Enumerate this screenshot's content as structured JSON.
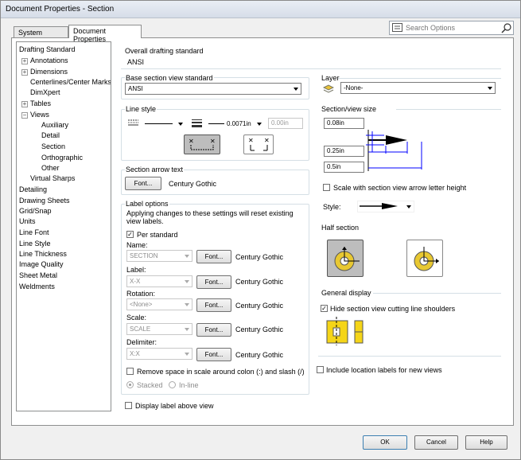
{
  "window": {
    "title": "Document Properties - Section"
  },
  "tabs": [
    {
      "label": "System Options"
    },
    {
      "label": "Document Properties"
    }
  ],
  "search": {
    "placeholder": "Search Options"
  },
  "tree": {
    "items": [
      {
        "label": "Drafting Standard"
      },
      {
        "label": "Annotations"
      },
      {
        "label": "Dimensions"
      },
      {
        "label": "Centerlines/Center Marks"
      },
      {
        "label": "DimXpert"
      },
      {
        "label": "Tables"
      },
      {
        "label": "Views"
      },
      {
        "label": "Auxiliary"
      },
      {
        "label": "Detail"
      },
      {
        "label": "Section"
      },
      {
        "label": "Orthographic"
      },
      {
        "label": "Other"
      },
      {
        "label": "Virtual Sharps"
      },
      {
        "label": "Detailing"
      },
      {
        "label": "Drawing Sheets"
      },
      {
        "label": "Grid/Snap"
      },
      {
        "label": "Units"
      },
      {
        "label": "Line Font"
      },
      {
        "label": "Line Style"
      },
      {
        "label": "Line Thickness"
      },
      {
        "label": "Image Quality"
      },
      {
        "label": "Sheet Metal"
      },
      {
        "label": "Weldments"
      }
    ]
  },
  "overall": {
    "label": "Overall drafting standard",
    "value": "ANSI"
  },
  "base_standard": {
    "label": "Base section view standard",
    "value": "ANSI"
  },
  "layer": {
    "label": "Layer",
    "value": "-None-"
  },
  "line_style": {
    "label": "Line style",
    "thickness": "0.0071in",
    "custom": "0.00in"
  },
  "section_size": {
    "label": "Section/view size",
    "v1": "0.08in",
    "v2": "0.25in",
    "v3": "0.5in"
  },
  "arrow_text": {
    "label": "Section arrow text",
    "font_btn": "Font...",
    "font": "Century Gothic"
  },
  "scale_with": {
    "label": "Scale with section view arrow letter height"
  },
  "style": {
    "label": "Style:"
  },
  "label_options": {
    "label": "Label options",
    "note": "Applying changes to these settings will reset existing view labels.",
    "per_standard": "Per standard",
    "name": {
      "label": "Name:",
      "value": "SECTION"
    },
    "lbl": {
      "label": "Label:",
      "value": "X-X"
    },
    "rotation": {
      "label": "Rotation:",
      "value": "<None>"
    },
    "scale": {
      "label": "Scale:",
      "value": "SCALE"
    },
    "delimiter": {
      "label": "Delimiter:",
      "value": "X:X"
    },
    "font_btn": "Font...",
    "font": "Century Gothic",
    "remove_space": "Remove space in scale around colon (:) and slash (/)",
    "stacked": "Stacked",
    "inline": "In-line"
  },
  "display_label": "Display label above view",
  "half_section": {
    "label": "Half section"
  },
  "general_display": {
    "label": "General display",
    "hide_shoulders": "Hide section view cutting line shoulders"
  },
  "include_location": "Include location labels for new views",
  "buttons": {
    "ok": "OK",
    "cancel": "Cancel",
    "help": "Help"
  }
}
